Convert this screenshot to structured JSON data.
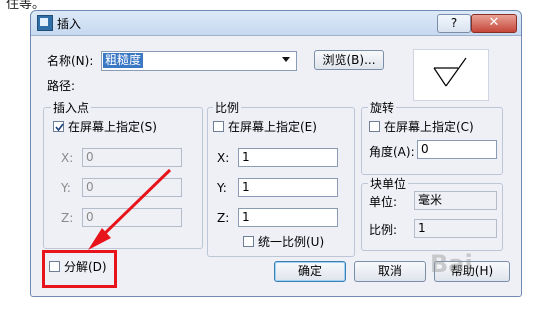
{
  "page_top_text": "住等。",
  "dialog": {
    "title": "插入",
    "help_label": "?",
    "close_label": "✕"
  },
  "name_row": {
    "label": "名称(N):",
    "value": "粗糙度",
    "browse_label": "浏览(B)..."
  },
  "path_label": "路径:",
  "insertion_point": {
    "title": "插入点",
    "specify_label": "在屏幕上指定(S)",
    "specify_checked": true,
    "fields": [
      {
        "label": "X:",
        "value": "0"
      },
      {
        "label": "Y:",
        "value": "0"
      },
      {
        "label": "Z:",
        "value": "0"
      }
    ]
  },
  "scale": {
    "title": "比例",
    "specify_label": "在屏幕上指定(E)",
    "specify_checked": false,
    "fields": [
      {
        "label": "X:",
        "value": "1"
      },
      {
        "label": "Y:",
        "value": "1"
      },
      {
        "label": "Z:",
        "value": "1"
      }
    ],
    "uniform_label": "统一比例(U)"
  },
  "rotation": {
    "title": "旋转",
    "specify_label": "在屏幕上指定(C)",
    "angle_label": "角度(A):",
    "angle_value": "0"
  },
  "block_unit": {
    "title": "块单位",
    "unit_label": "单位:",
    "unit_value": "毫米",
    "scale_label": "比例:",
    "scale_value": "1"
  },
  "explode_label": "分解(D)",
  "buttons": {
    "ok": "确定",
    "cancel": "取消",
    "help": "帮助(H)"
  },
  "watermark": "Bai",
  "colors": {
    "highlight": "#e8141b",
    "selection": "#3b78c4"
  }
}
